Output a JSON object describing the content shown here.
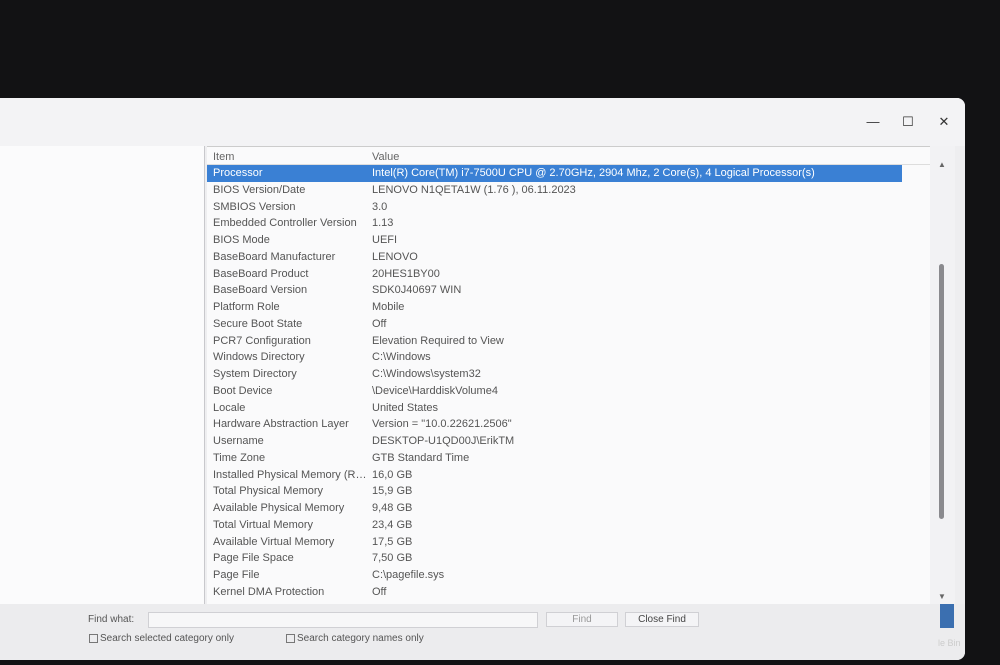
{
  "window": {
    "controls": {
      "minimize": "—",
      "maximize": "☐",
      "close": "✕"
    }
  },
  "table": {
    "headers": {
      "item": "Item",
      "value": "Value"
    },
    "rows": [
      {
        "item": "Processor",
        "value": "Intel(R) Core(TM) i7-7500U CPU @ 2.70GHz, 2904 Mhz, 2 Core(s), 4 Logical Processor(s)"
      },
      {
        "item": "BIOS Version/Date",
        "value": "LENOVO N1QETA1W (1.76 ), 06.11.2023"
      },
      {
        "item": "SMBIOS Version",
        "value": "3.0"
      },
      {
        "item": "Embedded Controller Version",
        "value": "1.13"
      },
      {
        "item": "BIOS Mode",
        "value": "UEFI"
      },
      {
        "item": "BaseBoard Manufacturer",
        "value": "LENOVO"
      },
      {
        "item": "BaseBoard Product",
        "value": "20HES1BY00"
      },
      {
        "item": "BaseBoard Version",
        "value": "SDK0J40697 WIN"
      },
      {
        "item": "Platform Role",
        "value": "Mobile"
      },
      {
        "item": "Secure Boot State",
        "value": "Off"
      },
      {
        "item": "PCR7 Configuration",
        "value": "Elevation Required to View"
      },
      {
        "item": "Windows Directory",
        "value": "C:\\Windows"
      },
      {
        "item": "System Directory",
        "value": "C:\\Windows\\system32"
      },
      {
        "item": "Boot Device",
        "value": "\\Device\\HarddiskVolume4"
      },
      {
        "item": "Locale",
        "value": "United States"
      },
      {
        "item": "Hardware Abstraction Layer",
        "value": "Version = \"10.0.22621.2506\""
      },
      {
        "item": "Username",
        "value": "DESKTOP-U1QD00J\\ErikTM"
      },
      {
        "item": "Time Zone",
        "value": "GTB Standard Time"
      },
      {
        "item": "Installed Physical Memory (RA...",
        "value": "16,0 GB"
      },
      {
        "item": "Total Physical Memory",
        "value": "15,9 GB"
      },
      {
        "item": "Available Physical Memory",
        "value": "9,48 GB"
      },
      {
        "item": "Total Virtual Memory",
        "value": "23,4 GB"
      },
      {
        "item": "Available Virtual Memory",
        "value": "17,5 GB"
      },
      {
        "item": "Page File Space",
        "value": "7,50 GB"
      },
      {
        "item": "Page File",
        "value": "C:\\pagefile.sys"
      },
      {
        "item": "Kernel DMA Protection",
        "value": "Off"
      }
    ]
  },
  "find": {
    "label": "Find what:",
    "value": "",
    "find_button": "Find",
    "close_button": "Close Find",
    "opt1": "Search selected category only",
    "opt2": "Search category names only"
  },
  "desktop": {
    "recycle_bin_fragment": "le Bin"
  }
}
